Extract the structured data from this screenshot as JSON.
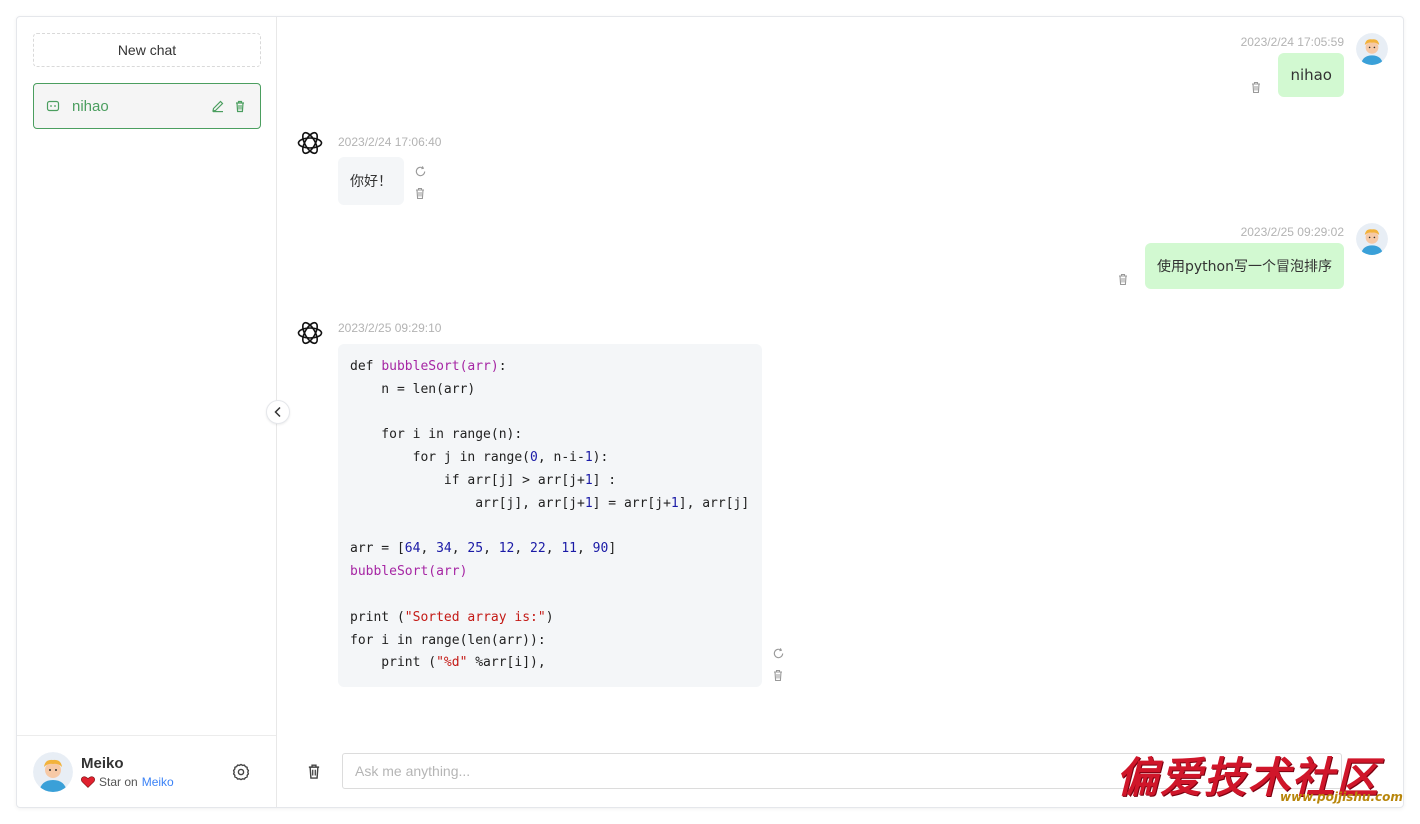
{
  "sidebar": {
    "new_chat_label": "New chat",
    "conversations": [
      {
        "title": "nihao",
        "active": true
      }
    ],
    "user": {
      "name": "Meiko",
      "star_prefix": "Star on",
      "star_link": "Meiko"
    }
  },
  "messages": [
    {
      "role": "user",
      "timestamp": "2023/2/24 17:05:59",
      "text": "nihao"
    },
    {
      "role": "assistant",
      "timestamp": "2023/2/24 17:06:40",
      "text": "你好！"
    },
    {
      "role": "user",
      "timestamp": "2023/2/25 09:29:02",
      "text": "使用python写一个冒泡排序"
    },
    {
      "role": "assistant",
      "timestamp": "2023/2/25 09:29:10",
      "code": [
        "def bubbleSort(arr):",
        "    n = len(arr)",
        "",
        "    for i in range(n):",
        "        for j in range(0, n-i-1):",
        "            if arr[j] > arr[j+1] :",
        "                arr[j], arr[j+1] = arr[j+1], arr[j]",
        "",
        "arr = [64, 34, 25, 12, 22, 11, 90]",
        "bubbleSort(arr)",
        "",
        "print (\"Sorted array is:\")",
        "for i in range(len(arr)):",
        "    print (\"%d\" %arr[i]),"
      ]
    }
  ],
  "input": {
    "placeholder": "Ask me anything..."
  },
  "watermark": {
    "title": "偏爱技术社区",
    "url": "www.pojjishu.com"
  },
  "colors": {
    "accent": "#4b9e5f",
    "user_bubble": "#d2f9d1",
    "bot_bubble": "#f4f6f8",
    "link": "#3b82f6"
  }
}
